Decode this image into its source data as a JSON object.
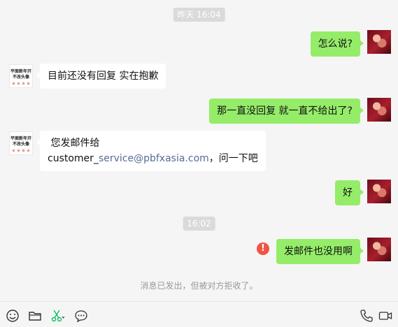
{
  "timestamps": {
    "first": "昨天 16:04",
    "second": "16:02"
  },
  "other_avatar": {
    "line1": "平面新年开",
    "line2": "不改头像"
  },
  "messages": {
    "m1": "怎么说?",
    "m2": "目前还没有回复 实在抱歉",
    "m3": "那一直没回复  就一直不给出了?",
    "m4_line1": " 您发邮件给",
    "m4_prefix": "customer_",
    "m4_link": "service@pbfxasia.com",
    "m4_suffix": "，问一下吧",
    "m5": "好",
    "m6": "发邮件也没用啊"
  },
  "error_mark": "!",
  "notice": "消息已发出，但被对方拒收了。",
  "toolbar": {
    "left": [
      "emoji-icon",
      "folder-icon",
      "scissors-icon",
      "chat-bubble-icon"
    ],
    "right": [
      "phone-icon",
      "video-icon"
    ]
  },
  "colors": {
    "my_bubble": "#95ec69",
    "other_bubble": "#ffffff",
    "link": "#576b95",
    "error": "#f25345"
  }
}
